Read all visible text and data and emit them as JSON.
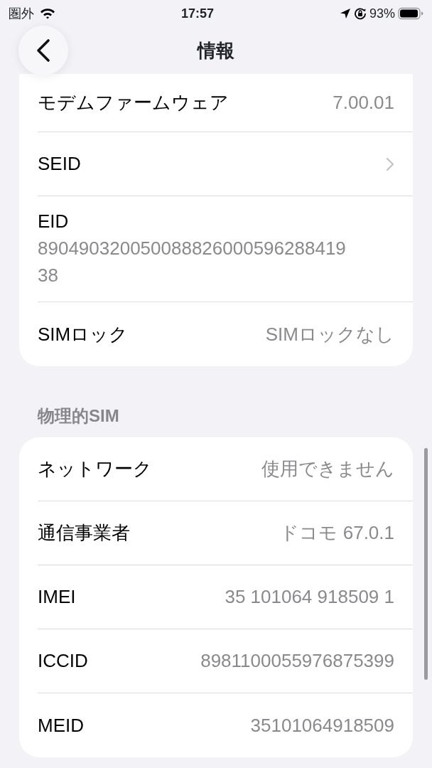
{
  "status_bar": {
    "carrier": "圏外",
    "time": "17:57",
    "battery": "93%"
  },
  "nav": {
    "title": "情報"
  },
  "sections": [
    {
      "rows": [
        {
          "kind": "value",
          "label": "モデムファームウェア",
          "value": "7.00.01"
        },
        {
          "kind": "link",
          "label": "SEID"
        },
        {
          "kind": "stacked",
          "label": "EID",
          "value": "89049032005008882600059628841938"
        },
        {
          "kind": "value",
          "label": "SIMロック",
          "value": "SIMロックなし"
        }
      ]
    },
    {
      "header": "物理的SIM",
      "rows": [
        {
          "kind": "value",
          "label": "ネットワーク",
          "value": "使用できません"
        },
        {
          "kind": "value",
          "label": "通信事業者",
          "value": "ドコモ 67.0.1"
        },
        {
          "kind": "value",
          "label": "IMEI",
          "value": "35 101064 918509 1"
        },
        {
          "kind": "value",
          "label": "ICCID",
          "value": "8981100055976875399"
        },
        {
          "kind": "value",
          "label": "MEID",
          "value": "35101064918509"
        }
      ]
    }
  ]
}
